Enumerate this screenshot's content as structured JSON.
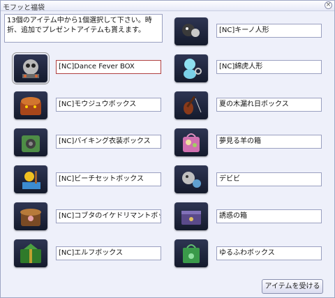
{
  "window": {
    "title": "モフッと福袋",
    "close_glyph": "×"
  },
  "description": "13個のアイテム中から1個選択して下さい。時折、追加でプレゼントアイテムも貰えます。",
  "accept_button": "アイテムを受ける",
  "items_left": [
    {
      "label": "[NC]Dance Fever BOX",
      "icon": "dance-fever-box-icon",
      "selected": true
    },
    {
      "label": "[NC]モウジュウボックス",
      "icon": "beast-box-icon"
    },
    {
      "label": "[NC]バイキング衣装ボックス",
      "icon": "viking-box-icon"
    },
    {
      "label": "[NC]ビーチセットボックス",
      "icon": "beach-box-icon"
    },
    {
      "label": "[NC]コブタのイケドリマントボックス",
      "icon": "piglet-box-icon"
    },
    {
      "label": "[NC]エルフボックス",
      "icon": "elf-box-icon"
    }
  ],
  "items_right": [
    {
      "label": "[NC]キーノ人形",
      "icon": "kino-doll-icon"
    },
    {
      "label": "[NC]綿虎人形",
      "icon": "tiger-doll-icon"
    },
    {
      "label": "夏の木漏れ日ボックス",
      "icon": "violin-box-icon"
    },
    {
      "label": "夢見る羊の箱",
      "icon": "sheep-bag-icon"
    },
    {
      "label": "デビビ",
      "icon": "devibi-icon"
    },
    {
      "label": "誘惑の箱",
      "icon": "temptation-box-icon"
    },
    {
      "label": "ゆるふわボックス",
      "icon": "fluffy-box-icon"
    }
  ]
}
